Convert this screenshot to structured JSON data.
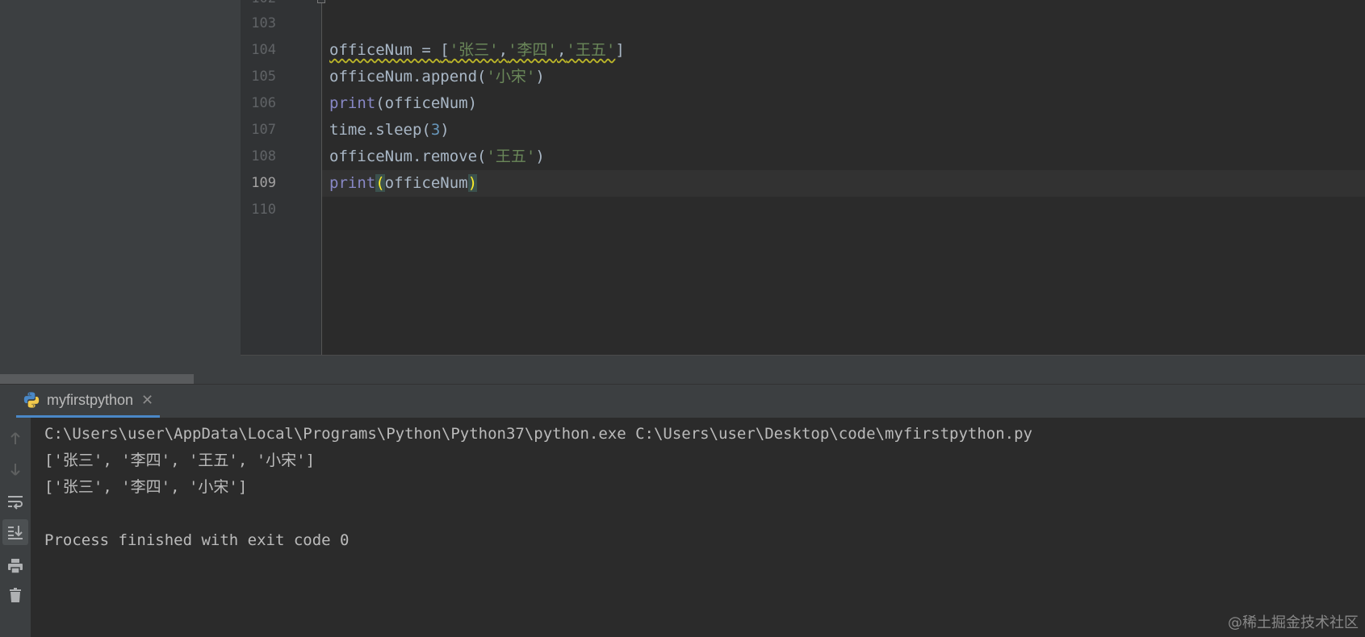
{
  "editor": {
    "partial_line_number": "102",
    "lines": [
      {
        "num": "103"
      },
      {
        "num": "104",
        "t1": "officeNum = ",
        "t2": "[",
        "s1": "'张三'",
        "c1": ",",
        "s2": "'李四'",
        "c2": ",",
        "s3": "'王五'",
        "t3": "]"
      },
      {
        "num": "105",
        "t1": "officeNum.append(",
        "s1": "'小宋'",
        "t2": ")"
      },
      {
        "num": "106",
        "b1": "print",
        "t1": "(officeNum)"
      },
      {
        "num": "107",
        "t1": "time.sleep(",
        "n1": "3",
        "t2": ")"
      },
      {
        "num": "108",
        "t1": "officeNum.remove(",
        "s1": "'王五'",
        "t2": ")"
      },
      {
        "num": "109",
        "b1": "print",
        "p1": "(",
        "t1": "officeNum",
        "p2": ")"
      },
      {
        "num": "110"
      }
    ]
  },
  "run": {
    "tab_label": "myfirstpython",
    "tab_icon": "python-icon",
    "toolbar_icons": [
      "arrow-up-icon",
      "arrow-down-icon",
      "soft-wrap-icon",
      "scroll-to-end-icon",
      "print-icon",
      "trash-icon"
    ],
    "console_lines": [
      "C:\\Users\\user\\AppData\\Local\\Programs\\Python\\Python37\\python.exe C:\\Users\\user\\Desktop\\code\\myfirstpython.py",
      "['张三', '李四', '王五', '小宋']",
      "['张三', '李四', '小宋']",
      "",
      "Process finished with exit code 0"
    ]
  },
  "watermark": "@稀土掘金技术社区",
  "colors": {
    "editor_bg": "#2b2b2b",
    "panel_bg": "#3c3f41",
    "string": "#6a8759",
    "number": "#6897bb",
    "builtin": "#8888c6",
    "brace_match": "#ffef28",
    "tab_underline": "#4a88c7"
  }
}
